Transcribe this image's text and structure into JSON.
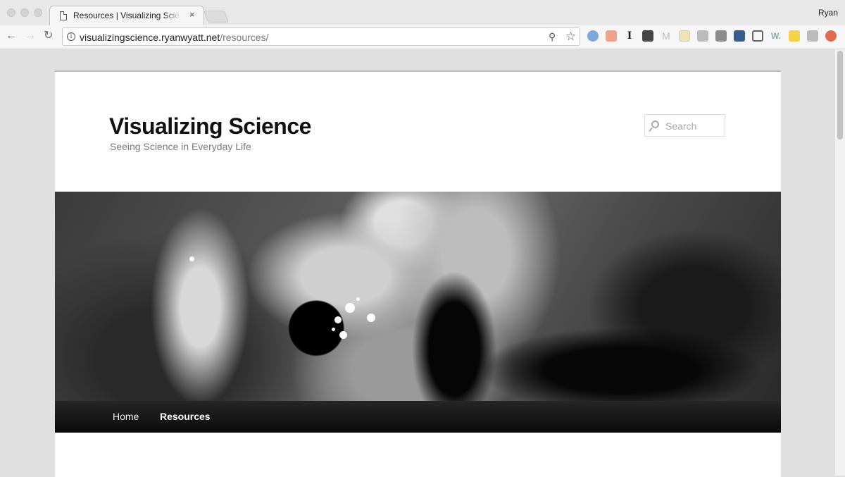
{
  "browser": {
    "tab_title": "Resources | Visualizing Science",
    "tab_close": "×",
    "profile_name": "Ryan",
    "url_host": "visualizingscience.ryanwyatt.net",
    "url_path": "/resources/",
    "extensions": [
      "star-extension-icon",
      "karma-icon",
      "instapaper-icon",
      "account-icon",
      "gmail-icon",
      "notes-icon",
      "pocket-icon",
      "mail-icon",
      "bird-icon",
      "screenshot-icon",
      "w-icon",
      "camera-icon",
      "person-icon",
      "upload-icon"
    ]
  },
  "site": {
    "title": "Visualizing Science",
    "description": "Seeing Science in Everyday Life",
    "search_placeholder": "Search"
  },
  "nav": {
    "items": [
      {
        "label": "Home",
        "current": false
      },
      {
        "label": "Resources",
        "current": true
      }
    ]
  },
  "colors": {
    "nav_bg": "#1a1a1a",
    "title_color": "#111111",
    "desc_color": "#7a7a7a"
  }
}
